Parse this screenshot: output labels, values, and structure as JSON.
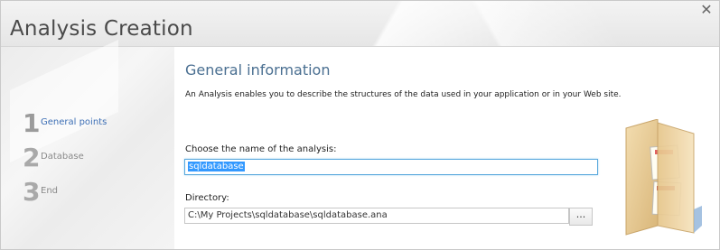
{
  "window": {
    "title": "Analysis Creation",
    "close_glyph": "✕"
  },
  "steps": [
    {
      "number": "1",
      "label": "General points",
      "active": true
    },
    {
      "number": "2",
      "label": "Database",
      "active": false
    },
    {
      "number": "3",
      "label": "End",
      "active": false
    }
  ],
  "main": {
    "heading": "General information",
    "description": "An Analysis enables you to describe the structures of the data used in your application or in your Web site.",
    "name_label": "Choose the name of the analysis:",
    "name_value": "sqldatabase",
    "directory_label": "Directory:",
    "directory_value": "C:\\My Projects\\sqldatabase\\sqldatabase.ana",
    "browse_label": "...",
    "illustration_icon": "folder-documents-icon"
  },
  "colors": {
    "accent": "#3d6fb5",
    "heading": "#4a6f91",
    "input_focus": "#5aa9dd",
    "selection": "#3399ff"
  }
}
